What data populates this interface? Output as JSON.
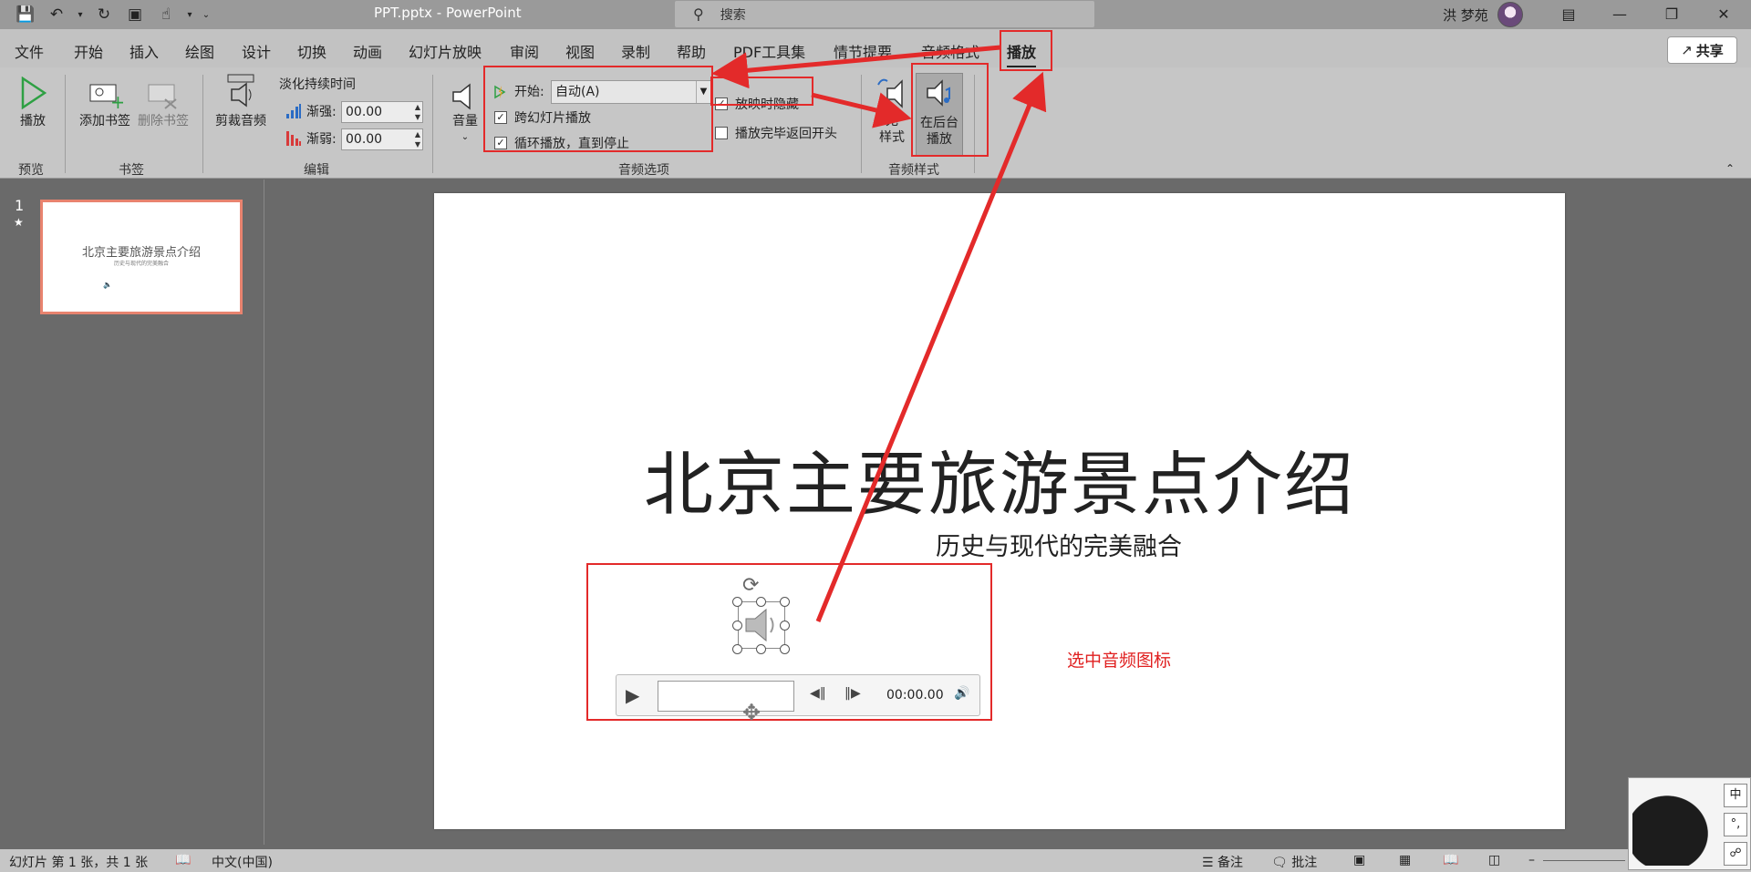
{
  "titlebar": {
    "doc_title": "PPT.pptx  -  PowerPoint",
    "search_placeholder": "搜索",
    "user_name": "洪 梦苑"
  },
  "tabs": [
    {
      "label": "文件"
    },
    {
      "label": "开始"
    },
    {
      "label": "插入"
    },
    {
      "label": "绘图"
    },
    {
      "label": "设计"
    },
    {
      "label": "切换"
    },
    {
      "label": "动画"
    },
    {
      "label": "幻灯片放映"
    },
    {
      "label": "审阅"
    },
    {
      "label": "视图"
    },
    {
      "label": "录制"
    },
    {
      "label": "帮助"
    },
    {
      "label": "PDF工具集"
    },
    {
      "label": "情节提要"
    },
    {
      "label": "音频格式"
    },
    {
      "label": "播放"
    }
  ],
  "share_label": "共享",
  "ribbon": {
    "preview": {
      "play_label": "播放",
      "group": "预览"
    },
    "bookmarks": {
      "add_label": "添加书签",
      "remove_label": "删除书签",
      "group": "书签"
    },
    "editing": {
      "trim_label": "剪裁音频",
      "fade_title": "淡化持续时间",
      "fade_in_label": "渐强:",
      "fade_in_value": "00.00",
      "fade_out_label": "渐弱:",
      "fade_out_value": "00.00",
      "group": "编辑"
    },
    "audio_options": {
      "volume_label": "音量",
      "start_label": "开始:",
      "start_value": "自动(A)",
      "cross_slides_label": "跨幻灯片播放",
      "loop_label": "循环播放，直到停止",
      "hide_label": "放映时隐藏",
      "rewind_label": "播放完毕返回开头",
      "group": "音频选项"
    },
    "audio_styles": {
      "no_style_line1": "无",
      "no_style_line2": "样式",
      "bg_play_line1": "在后台",
      "bg_play_line2": "播放",
      "group": "音频样式"
    }
  },
  "thumbnails": {
    "slide_number": "1",
    "title": "北京主要旅游景点介绍",
    "subtitle": "历史与现代的完美融合"
  },
  "slide": {
    "title": "北京主要旅游景点介绍",
    "subtitle": "历史与现代的完美融合",
    "annotation": "选中音频图标",
    "player_time": "00:00.00"
  },
  "statusbar": {
    "slide_info": "幻灯片 第 1 张，共 1 张",
    "language": "中文(中国)",
    "notes_label": "备注",
    "comments_label": "批注"
  },
  "ime": {
    "key1": "中",
    "key2": "°,"
  },
  "colors": {
    "annotation_red": "#e32a2a",
    "accent_green": "#2ea043"
  }
}
